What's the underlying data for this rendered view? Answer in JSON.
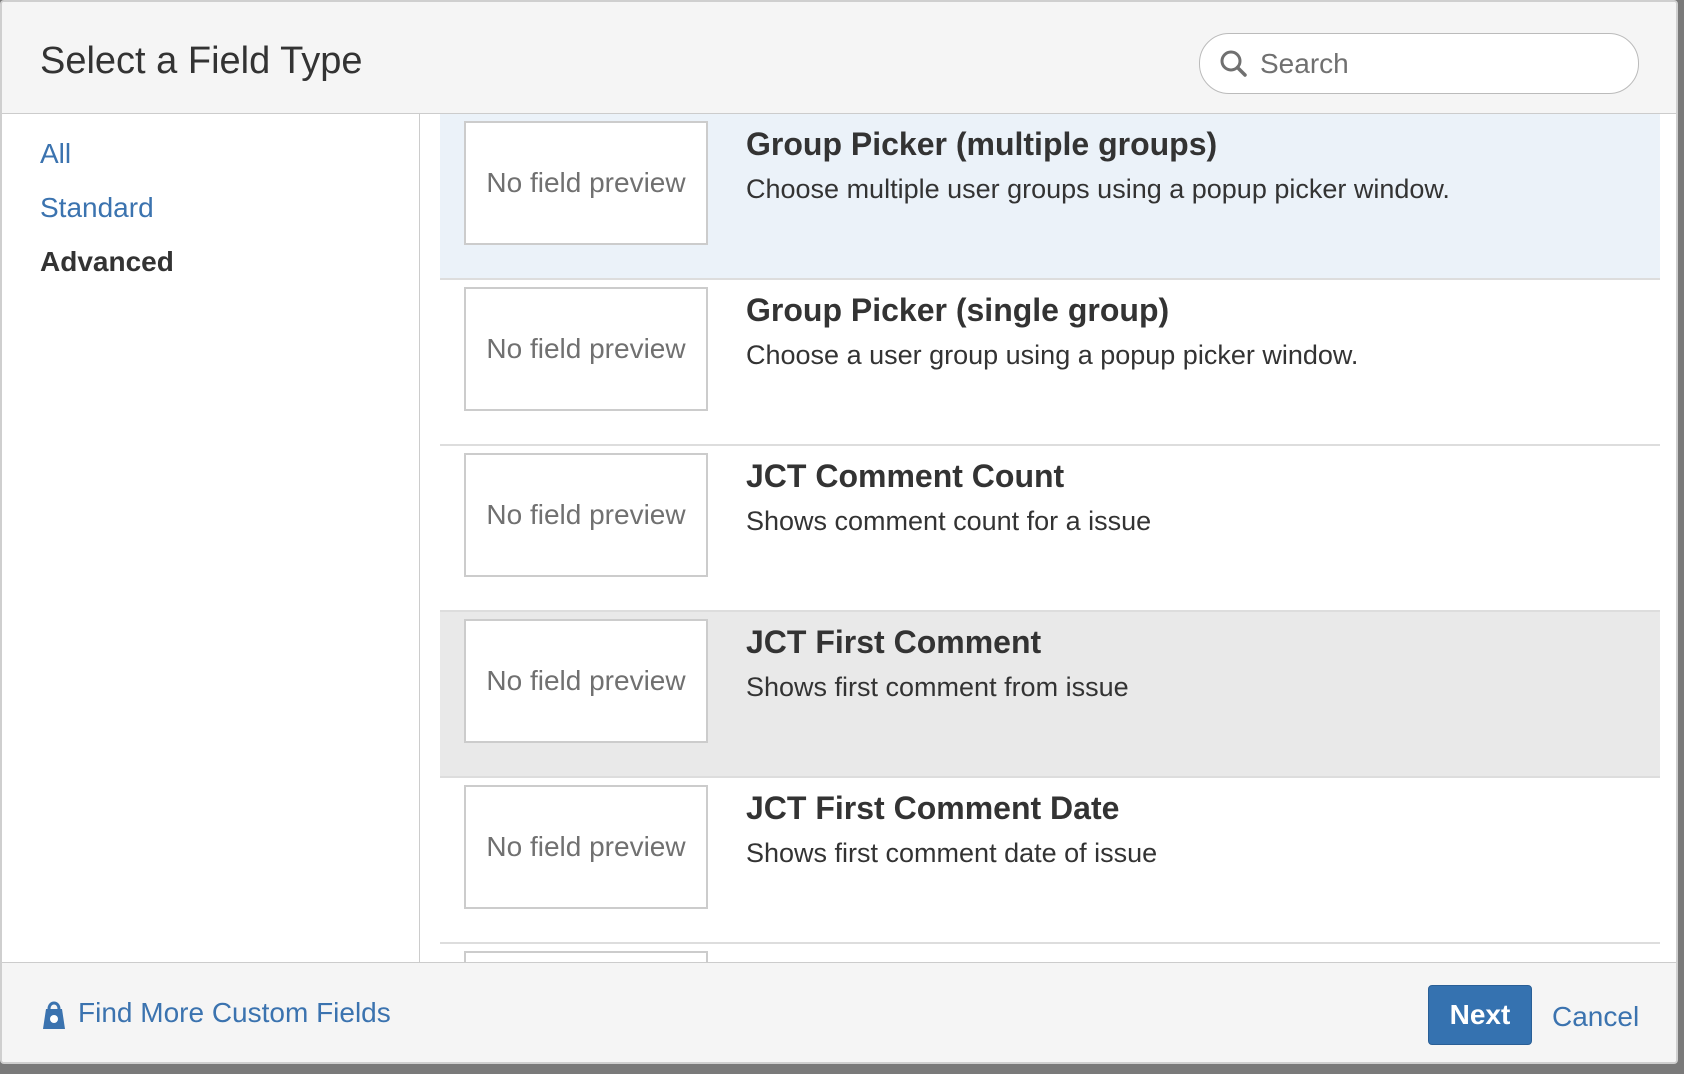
{
  "header": {
    "title": "Select a Field Type",
    "search_placeholder": "Search"
  },
  "sidebar": {
    "items": [
      {
        "label": "All",
        "active": false
      },
      {
        "label": "Standard",
        "active": false
      },
      {
        "label": "Advanced",
        "active": true
      }
    ]
  },
  "fields": [
    {
      "preview": "No field preview",
      "title": "Group Picker (multiple groups)",
      "description": "Choose multiple user groups using a popup picker window.",
      "state": "selected"
    },
    {
      "preview": "No field preview",
      "title": "Group Picker (single group)",
      "description": "Choose a user group using a popup picker window.",
      "state": "normal"
    },
    {
      "preview": "No field preview",
      "title": "JCT Comment Count",
      "description": "Shows comment count for a issue",
      "state": "normal"
    },
    {
      "preview": "No field preview",
      "title": "JCT First Comment",
      "description": "Shows first comment from issue",
      "state": "hover"
    },
    {
      "preview": "No field preview",
      "title": "JCT First Comment Date",
      "description": "Shows first comment date of issue",
      "state": "normal"
    }
  ],
  "footer": {
    "find_more_label": "Find More Custom Fields",
    "find_more_icon": "marketplace-icon",
    "next_label": "Next",
    "cancel_label": "Cancel"
  },
  "colors": {
    "link": "#3b73af",
    "primary_button": "#3572b0",
    "selected_row": "#ebf2f9",
    "hover_row": "#e9e9e9"
  }
}
